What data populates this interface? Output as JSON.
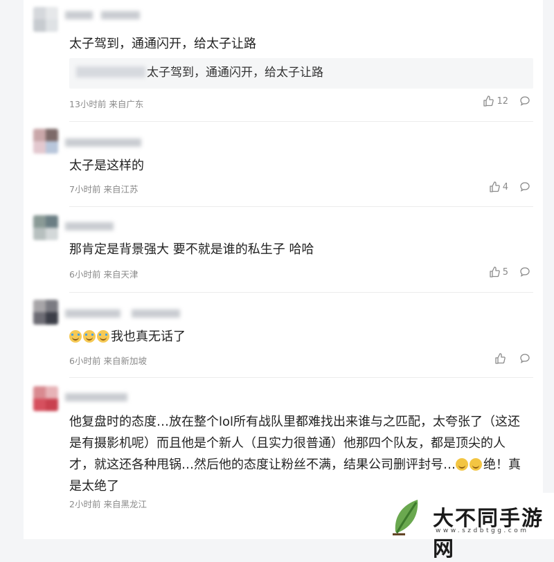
{
  "comments": [
    {
      "text": "太子驾到，通通闪开，给太子让路",
      "quote_text": "太子驾到，通通闪开，给太子让路",
      "time": "13小时前",
      "location": "来自广东",
      "likes": "12"
    },
    {
      "text": "太子是这样的",
      "time": "7小时前",
      "location": "来自江苏",
      "likes": "4"
    },
    {
      "text": "那肯定是背景强大 要不就是谁的私生子 哈哈",
      "time": "6小时前",
      "location": "来自天津",
      "likes": "5"
    },
    {
      "text": "我也真无话了",
      "emoji_prefix": "crying-face x3",
      "time": "6小时前",
      "location": "来自新加坡",
      "likes": ""
    },
    {
      "text": "他复盘时的态度…放在整个lol所有战队里都难找出来谁与之匹配，太夸张了（这还是有摄影机呢）而且他是个新人（且实力很普通）他那四个队友，都是顶尖的人才，就这还各种甩锅…然后他的态度让粉丝不满，结果公司删评封号…",
      "text_tail": "绝！真是太绝了",
      "emoji_mid": "grinning-sweat-face x2",
      "time": "2小时前",
      "location": "来自黑龙江",
      "likes": ""
    }
  ],
  "icons": {
    "like": "thumbs-up-icon",
    "reply": "comment-bubble-icon"
  },
  "watermark": {
    "title": "大不同手游网",
    "url": "www.szdbtgg.com"
  },
  "colors": {
    "text": "#222222",
    "meta": "#8a8a8a",
    "quote_bg": "#f5f6f7"
  }
}
